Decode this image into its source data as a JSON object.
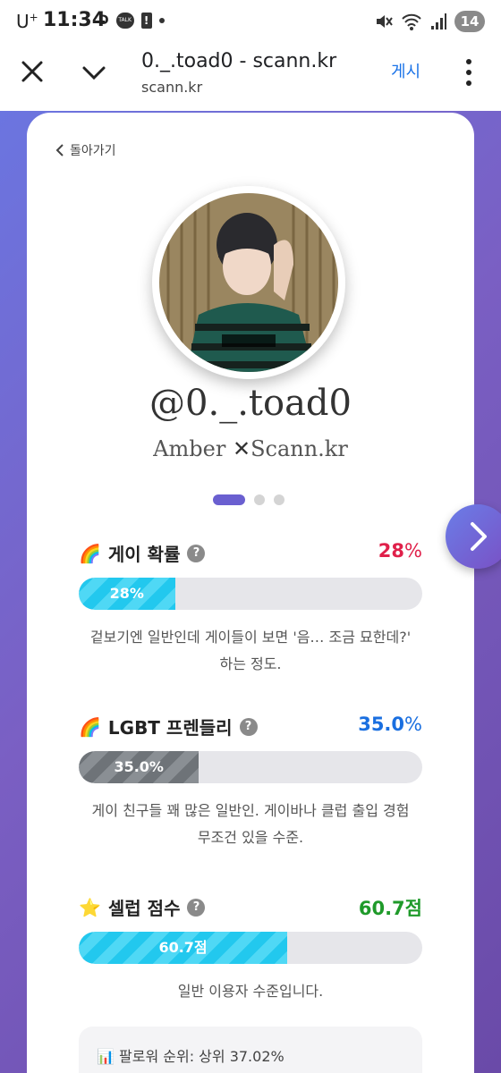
{
  "status_bar": {
    "carrier": "U",
    "carrier_sup": "+",
    "time": "11:34",
    "indicator_d": "D",
    "talk_label": "TALK",
    "alert": "!",
    "battery": "14"
  },
  "browser": {
    "title": "0._.toad0 - scann.kr",
    "url": "scann.kr",
    "post_label": "게시"
  },
  "page": {
    "back_label": "돌아가기",
    "handle": "@0._.toad0",
    "brand_left": "Amber",
    "brand_x": "✕",
    "brand_right": "Scann.kr",
    "pager_pages": 3,
    "pager_active": 1
  },
  "metrics": [
    {
      "emoji": "🌈",
      "label": "게이 확률",
      "value": "28",
      "unit": "%",
      "value_color": "#e0204a",
      "fill_pct": 28,
      "fill_label": "28%",
      "fill_style": "cyan",
      "desc": "겉보기엔 일반인데 게이들이 보면 '음… 조금 묘한데?' 하는 정도."
    },
    {
      "emoji": "🌈",
      "label": "LGBT 프렌들리",
      "value": "35.0",
      "unit": "%",
      "value_color": "#1a6fe0",
      "fill_pct": 35,
      "fill_label": "35.0%",
      "fill_style": "gray",
      "desc": "게이 친구들 꽤 많은 일반인. 게이바나 클럽 출입 경험 무조건 있을 수준."
    },
    {
      "emoji": "⭐",
      "label": "셀럽 점수",
      "value": "60.7점",
      "unit": "",
      "value_color": "#1f9a2a",
      "fill_pct": 60.7,
      "fill_label": "60.7점",
      "fill_style": "cyan",
      "desc": "일반 이용자 수준입니다."
    }
  ],
  "bottom": {
    "text": "📊 팔로워 순위: 상위 37.02%"
  },
  "colors": {
    "accent": "#6a5fd0",
    "link": "#1a73e8"
  }
}
